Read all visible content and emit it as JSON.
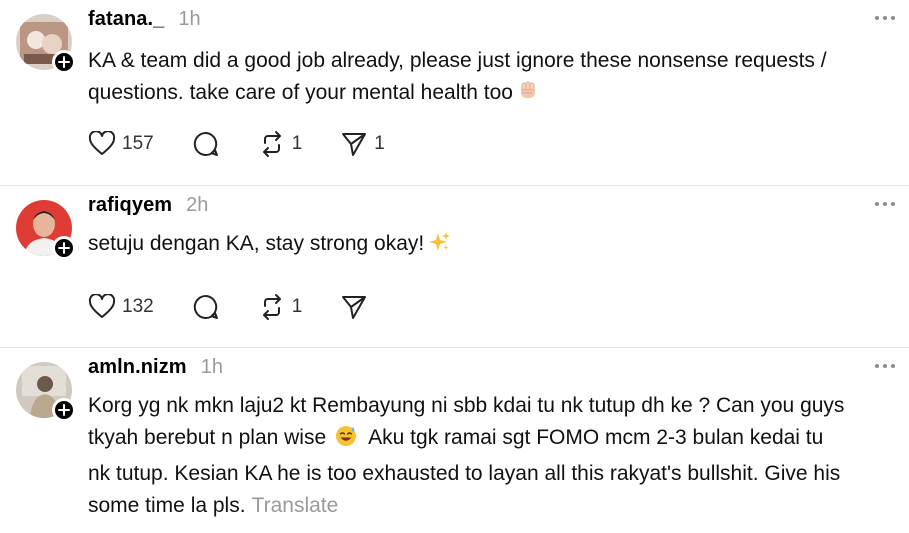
{
  "posts": [
    {
      "username": "fatana._",
      "time": "1h",
      "text_lines": [
        "KA & team did a good job already, please just ignore these nonsense requests /",
        "questions. take care of your mental health too"
      ],
      "emoji": "fist",
      "likes": "157",
      "reposts": "1",
      "shares": "1"
    },
    {
      "username": "rafiqyem",
      "time": "2h",
      "text_lines": [
        "setuju dengan KA, stay strong okay!"
      ],
      "emoji": "sparkles",
      "likes": "132",
      "reposts": "1"
    },
    {
      "username": "amln.nizm",
      "time": "1h",
      "text_lines": [
        "Korg yg nk mkn laju2 kt Rembayung ni sbb kdai tu nk tutup dh ke ? Can you guys",
        "tkyah berebut n plan wise",
        "Aku tgk ramai sgt FOMO mcm 2-3 bulan kedai tu",
        "nk tutup. Kesian KA he is too exhausted to layan all this rakyat's bullshit. Give his",
        "some time la pls."
      ],
      "translate": "Translate"
    }
  ]
}
